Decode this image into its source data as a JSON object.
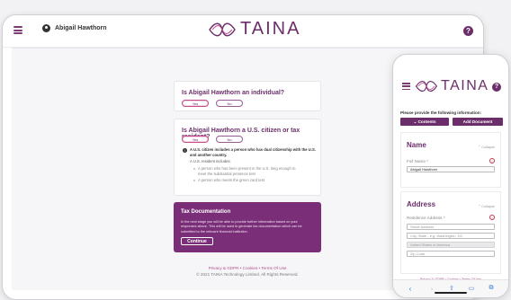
{
  "app": {
    "logo_text": "TAINA",
    "user_name": "Abigail Hawthorn",
    "brand_color": "#6b2e6a",
    "accent_color": "#7b2e78"
  },
  "desktop": {
    "q1": {
      "title": "Is Abigail Hawthorn an individual?",
      "yes": "Yes",
      "no": "No"
    },
    "q2": {
      "title": "Is Abigail Hawthorn a U.S. citizen or tax resident?",
      "yes": "Yes",
      "no": "No",
      "info_title": "A U.S. citizen includes a person who has dual citizenship with the U.S. and another country.",
      "info_sub": "A U.S. resident includes:",
      "bullets": [
        "A person who has been present in the U.S. long enough to meet the substantial presence test",
        "A person who meets the green card test"
      ]
    },
    "tax": {
      "title": "Tax Documentation",
      "body": "In the next stage you will be able to provide further information based on your responses above. This will be used to generate tax documentation which can be submitted to the relevant financial institution.",
      "continue_label": "Continue"
    },
    "footer": {
      "links": "Privacy & GDPR  •  Cookies  •  Terms Of Use",
      "copyright": "© 2021 TAINA Technology Limited. All Rights Reserved."
    }
  },
  "phone": {
    "info_heading": "Please provide the following information:",
    "contents_label": "Contents",
    "add_document_label": "Add Document",
    "name_section": {
      "title": "Name",
      "collapse": "Collapse",
      "label": "Full Name *",
      "value": "Abigail Hawthorn"
    },
    "address_section": {
      "title": "Address",
      "collapse": "Collapse",
      "label": "Residence Address *",
      "street_placeholder": "Street Address",
      "city_placeholder": "City, State - e.g. Washington, DC",
      "country_value": "United States of America",
      "zip_placeholder": "Zip Code"
    },
    "footer": {
      "links": "Privacy & GDPR  •  Cookies  •  Terms Of Use",
      "copyright": "© 2021 TAINA Technology Limited. All Rights Reserved."
    }
  }
}
